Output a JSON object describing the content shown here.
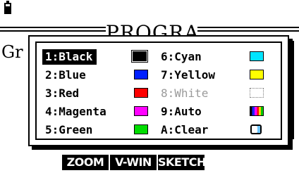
{
  "background_title": "PROGRAM",
  "background_text": "Gr",
  "color_menu": {
    "items": [
      {
        "label": "1:Black",
        "swatch": "#000000",
        "selected": true,
        "enabled": true
      },
      {
        "label": "2:Blue",
        "swatch": "#0020ff",
        "selected": false,
        "enabled": true
      },
      {
        "label": "3:Red",
        "swatch": "#ff0000",
        "selected": false,
        "enabled": true
      },
      {
        "label": "4:Magenta",
        "swatch": "#ff00ff",
        "selected": false,
        "enabled": true
      },
      {
        "label": "5:Green",
        "swatch": "#00dd00",
        "selected": false,
        "enabled": true
      },
      {
        "label": "6:Cyan",
        "swatch": "#00e5ff",
        "selected": false,
        "enabled": true
      },
      {
        "label": "7:Yellow",
        "swatch": "#ffff00",
        "selected": false,
        "enabled": true
      },
      {
        "label": "8:White",
        "swatch": "#ffffff",
        "selected": false,
        "enabled": false
      },
      {
        "label": "9:Auto",
        "swatch": "multicolor",
        "selected": false,
        "enabled": true
      },
      {
        "label": "A:Clear",
        "swatch": "eraser-icon",
        "selected": false,
        "enabled": true
      }
    ]
  },
  "function_keys": [
    "ZOOM",
    "V-WIN",
    "SKETCH"
  ]
}
